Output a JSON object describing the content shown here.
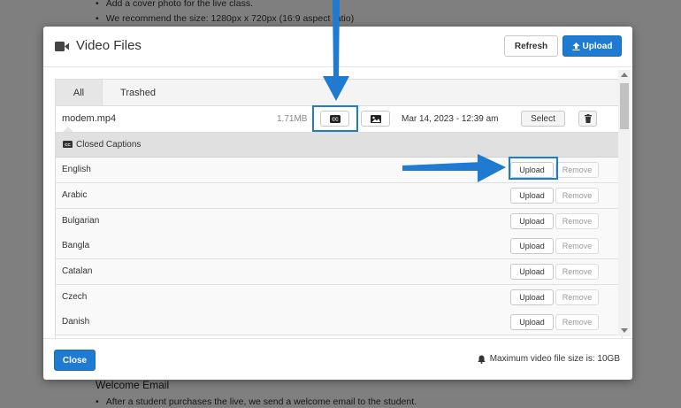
{
  "background": {
    "lines": [
      "Add a cover photo for the live class.",
      "We recommend the size: 1280px x 720px (16:9 aspect ratio)"
    ],
    "heading": "Welcome Email",
    "bottom_line": "After a student purchases the live, we send a welcome email to the student."
  },
  "modal": {
    "title": "Video Files",
    "title_icon": "video-camera-icon",
    "refresh_label": "Refresh",
    "upload_label": "Upload",
    "tabs": [
      {
        "label": "All",
        "active": true
      },
      {
        "label": "Trashed",
        "active": false
      }
    ],
    "file": {
      "name": "modem.mp4",
      "size": "1.71MB",
      "date": "Mar 14, 2023 - 12:39 am",
      "select_label": "Select"
    },
    "captions": {
      "header": "Closed Captions",
      "upload_label": "Upload",
      "remove_label": "Remove",
      "languages": [
        "English",
        "Arabic",
        "Bulgarian",
        "Bangla",
        "Catalan",
        "Czech",
        "Danish"
      ]
    },
    "close_label": "Close",
    "footer_note": "Maximum video file size is: 10GB"
  },
  "colors": {
    "primary": "#1f7ad1",
    "annotation": "#1f7ad1"
  }
}
